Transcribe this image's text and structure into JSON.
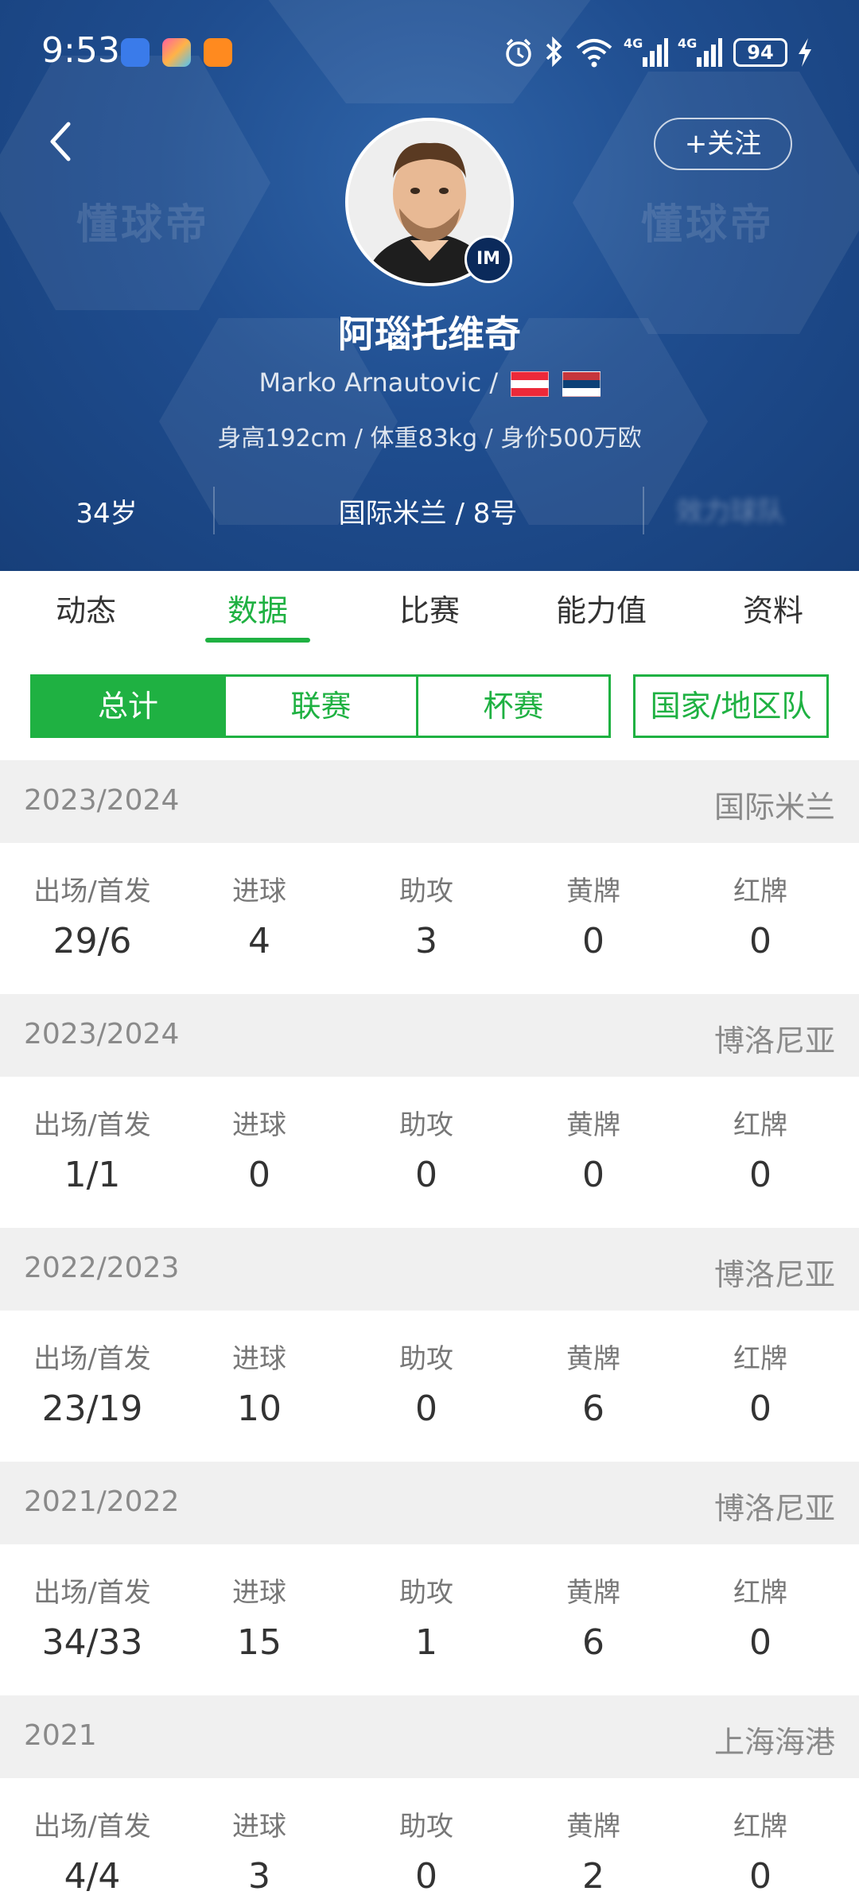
{
  "status_bar": {
    "time": "9:53",
    "battery": "94"
  },
  "header": {
    "follow_label": "+关注",
    "watermark": "懂球帝",
    "name_cn": "阿瑙托维奇",
    "name_en": "Marko Arnautovic /",
    "club_badge": "IM",
    "info": "身高192cm / 体重83kg / 身价500万欧",
    "age": "34岁",
    "club_number": "国际米兰 / 8号",
    "blurred": "效力球队"
  },
  "tabs": [
    "动态",
    "数据",
    "比赛",
    "能力值",
    "资料"
  ],
  "segments": [
    "总计",
    "联赛",
    "杯赛",
    "国家/地区队"
  ],
  "stat_labels": [
    "出场/首发",
    "进球",
    "助攻",
    "黄牌",
    "红牌"
  ],
  "seasons": [
    {
      "year": "2023/2024",
      "club": "国际米兰",
      "values": [
        "29/6",
        "4",
        "3",
        "0",
        "0"
      ]
    },
    {
      "year": "2023/2024",
      "club": "博洛尼亚",
      "values": [
        "1/1",
        "0",
        "0",
        "0",
        "0"
      ]
    },
    {
      "year": "2022/2023",
      "club": "博洛尼亚",
      "values": [
        "23/19",
        "10",
        "0",
        "6",
        "0"
      ]
    },
    {
      "year": "2021/2022",
      "club": "博洛尼亚",
      "values": [
        "34/33",
        "15",
        "1",
        "6",
        "0"
      ]
    },
    {
      "year": "2021",
      "club": "上海海港",
      "values": [
        "4/4",
        "3",
        "0",
        "2",
        "0"
      ]
    }
  ],
  "colors": {
    "header_blue": "#1f4d8f",
    "accent_green": "#1fb142"
  }
}
